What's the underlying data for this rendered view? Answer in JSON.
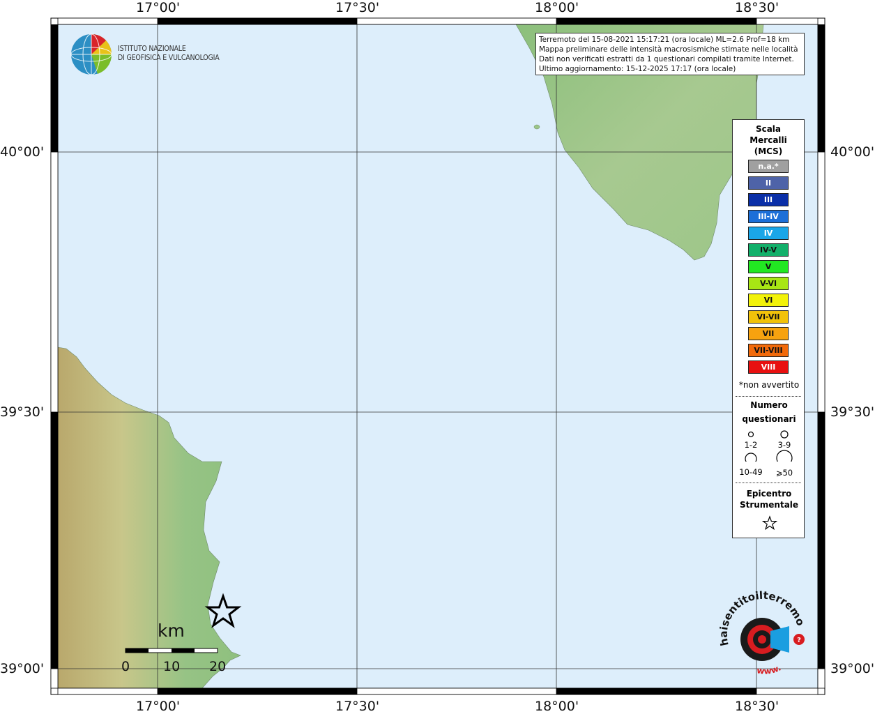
{
  "coords": {
    "top": [
      "17°00'",
      "17°30'",
      "18°00'",
      "18°30'"
    ],
    "bottom": [
      "17°00'",
      "17°30'",
      "18°00'",
      "18°30'"
    ],
    "left": [
      "40°00'",
      "39°30'",
      "39°00'"
    ],
    "right": [
      "40°00'",
      "39°30'",
      "39°00'"
    ]
  },
  "logo": {
    "line1": "ISTITUTO NAZIONALE",
    "line2": "DI GEOFISICA E VULCANOLOGIA"
  },
  "info": [
    "Terremoto del 15-08-2021 15:17:21 (ora locale) ML=2.6 Prof=18 km",
    "Mappa preliminare delle intensità macrosismiche stimate nelle località",
    "Dati non verificati estratti da 1 questionari compilati tramite Internet.",
    "Ultimo aggiornamento: 15-12-2025 17:17 (ora locale)"
  ],
  "legend": {
    "title_lines": [
      "Scala",
      "Mercalli",
      "(MCS)"
    ],
    "intensities": [
      {
        "label": "n.a.*",
        "color": "#a0a0a0"
      },
      {
        "label": "II",
        "color": "#4e63a8"
      },
      {
        "label": "III",
        "color": "#0a2fa8"
      },
      {
        "label": "III-IV",
        "color": "#1c6fd8"
      },
      {
        "label": "IV",
        "color": "#1aa6e8"
      },
      {
        "label": "IV-V",
        "color": "#12b06a"
      },
      {
        "label": "V",
        "color": "#22e822"
      },
      {
        "label": "V-VI",
        "color": "#a8e614"
      },
      {
        "label": "VI",
        "color": "#f2f20a"
      },
      {
        "label": "VI-VII",
        "color": "#f2c20a"
      },
      {
        "label": "VII",
        "color": "#f7a20f"
      },
      {
        "label": "VII-VIII",
        "color": "#f26a0a"
      },
      {
        "label": "VIII",
        "color": "#e81010"
      }
    ],
    "note": "*non avvertito",
    "count_title_1": "Numero",
    "count_title_2": "questionari",
    "counts": [
      "1-2",
      "3-9",
      "10-49",
      "⩾50"
    ],
    "epi_title_1": "Epicentro",
    "epi_title_2": "Strumentale"
  },
  "scale_bar": {
    "unit": "km",
    "ticks": [
      "0",
      "10",
      "20"
    ]
  },
  "watermark": {
    "text": "haisentitoilterremoto.it",
    "prefix": "www."
  },
  "colors": {
    "sea": "#ddeefb",
    "land_low": "#8fbf7a",
    "land_high": "#c4b47a",
    "frame": "#000000"
  }
}
